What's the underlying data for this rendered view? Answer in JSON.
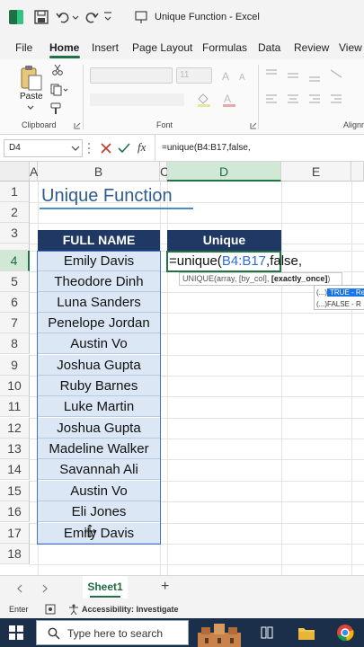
{
  "window": {
    "title": "Unique Function  -  Excel"
  },
  "menu": {
    "tabs": [
      "File",
      "Home",
      "Insert",
      "Page Layout",
      "Formulas",
      "Data",
      "Review",
      "View"
    ],
    "active": "Home"
  },
  "ribbon": {
    "paste_label": "Paste",
    "clipboard_label": "Clipboard",
    "font_label": "Font",
    "alignment_label": "Alignm",
    "font_size": "11"
  },
  "formula_bar": {
    "name_box": "D4",
    "fx": "fx",
    "formula": "=unique(B4:B17,false,"
  },
  "columns": [
    "A",
    "B",
    "C",
    "D",
    "E"
  ],
  "rows": [
    "1",
    "2",
    "3",
    "4",
    "5",
    "6",
    "7",
    "8",
    "9",
    "10",
    "11",
    "12",
    "13",
    "14",
    "15",
    "16",
    "17",
    "18"
  ],
  "sheet": {
    "title": "Unique Function",
    "header_full_name": "FULL NAME",
    "header_unique": "Unique",
    "names": [
      "Emily Davis",
      "Theodore Dinh",
      "Luna Sanders",
      "Penelope Jordan",
      "Austin Vo",
      "Joshua Gupta",
      "Ruby Barnes",
      "Luke Martin",
      "Joshua Gupta",
      "Madeline Walker",
      "Savannah Ali",
      "Austin Vo",
      "Eli Jones",
      "Emily Davis"
    ],
    "edit": {
      "prefix": "=unique(",
      "ref": "B4:B17",
      "suffix": ",false,"
    },
    "tooltip": {
      "text": "UNIQUE(array, [by_col], ",
      "bold": "[exactly_once]",
      "close": ")"
    },
    "autocomplete": [
      {
        "prefix": "(...)",
        "label": "TRUE - Re"
      },
      {
        "prefix": "(...)",
        "label": "FALSE - R"
      }
    ]
  },
  "sheet_tabs": {
    "active": "Sheet1",
    "add": "+"
  },
  "status": {
    "mode": "Enter",
    "accessibility": "Accessibility: Investigate"
  },
  "taskbar": {
    "search_placeholder": "Type here to search"
  }
}
